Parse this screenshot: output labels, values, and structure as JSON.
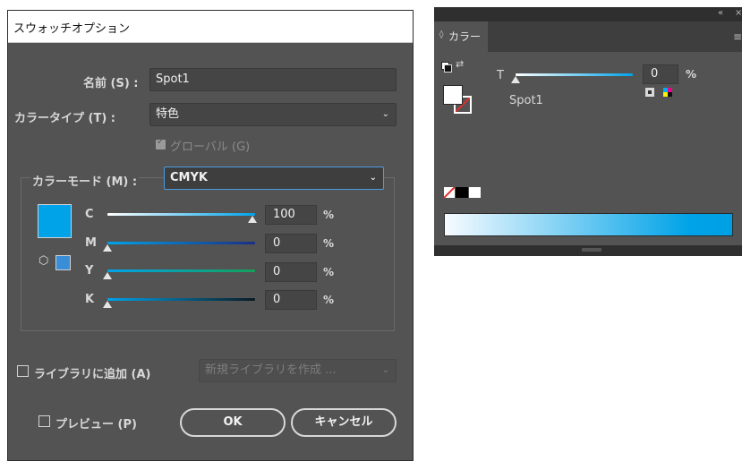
{
  "dialog": {
    "title": "スウォッチオプション",
    "name_label": "名前 (S) :",
    "name_value": "Spot1",
    "color_type_label": "カラータイプ (T) :",
    "color_type_value": "特色",
    "global_label": "グローバル (G)",
    "color_mode_label": "カラーモード (M) :",
    "color_mode_value": "CMYK",
    "swatch_color": "#00a3e8",
    "channels": [
      {
        "label": "C",
        "value": "100",
        "fraction": 1.0,
        "unit": "%"
      },
      {
        "label": "M",
        "value": "0",
        "fraction": 0,
        "unit": "%"
      },
      {
        "label": "Y",
        "value": "0",
        "fraction": 0,
        "unit": "%"
      },
      {
        "label": "K",
        "value": "0",
        "fraction": 0,
        "unit": "%"
      }
    ],
    "add_to_library_label": "ライブラリに追加 (A)",
    "library_placeholder": "新規ライブラリを作成 ...",
    "preview_label": "プレビュー (P)",
    "ok_label": "OK",
    "cancel_label": "キャンセル"
  },
  "panel": {
    "tab_label": "カラー",
    "tint_label": "T",
    "tint_value": "0",
    "tint_unit": "%",
    "swatch_name": "Spot1"
  }
}
